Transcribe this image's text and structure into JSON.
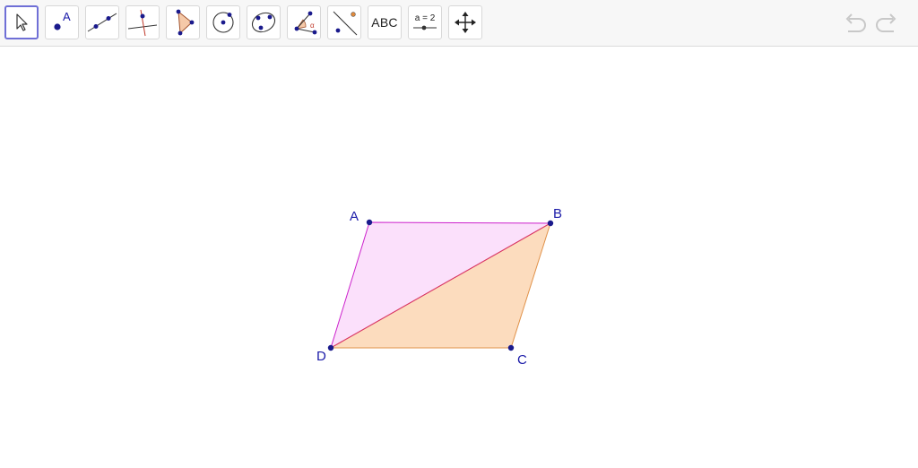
{
  "toolbar": {
    "tools": [
      {
        "id": "move",
        "icon": "arrow-cursor-icon",
        "selected": true
      },
      {
        "id": "point",
        "icon": "point-icon",
        "label": "A"
      },
      {
        "id": "line",
        "icon": "line-icon"
      },
      {
        "id": "perpendicular",
        "icon": "perpendicular-line-icon"
      },
      {
        "id": "polygon",
        "icon": "polygon-icon"
      },
      {
        "id": "circle",
        "icon": "circle-icon"
      },
      {
        "id": "conic",
        "icon": "conic-icon"
      },
      {
        "id": "angle",
        "icon": "angle-icon",
        "label": "α"
      },
      {
        "id": "reflect",
        "icon": "reflect-icon"
      },
      {
        "id": "text",
        "icon": "text-icon",
        "label": "ABC"
      },
      {
        "id": "slider",
        "icon": "slider-icon",
        "label": "a = 2"
      },
      {
        "id": "move-graphics",
        "icon": "move-graphics-icon"
      }
    ],
    "undo_icon": "undo-icon",
    "redo_icon": "redo-icon"
  },
  "construction": {
    "points": {
      "A": {
        "label": "A"
      },
      "B": {
        "label": "B"
      },
      "C": {
        "label": "C"
      },
      "D": {
        "label": "D"
      }
    },
    "polygons": [
      {
        "name": "triangle-ABD",
        "vertices": [
          "A",
          "B",
          "D"
        ],
        "fill": "#fbe0fb",
        "stroke": "#cc22cc"
      },
      {
        "name": "triangle-BCD",
        "vertices": [
          "B",
          "C",
          "D"
        ],
        "fill": "#fcdcbe",
        "stroke": "#e0924a"
      }
    ],
    "colors": {
      "point": "#1a1a8c",
      "label": "#1a1aa8",
      "diagonal": "#d9326a"
    }
  }
}
